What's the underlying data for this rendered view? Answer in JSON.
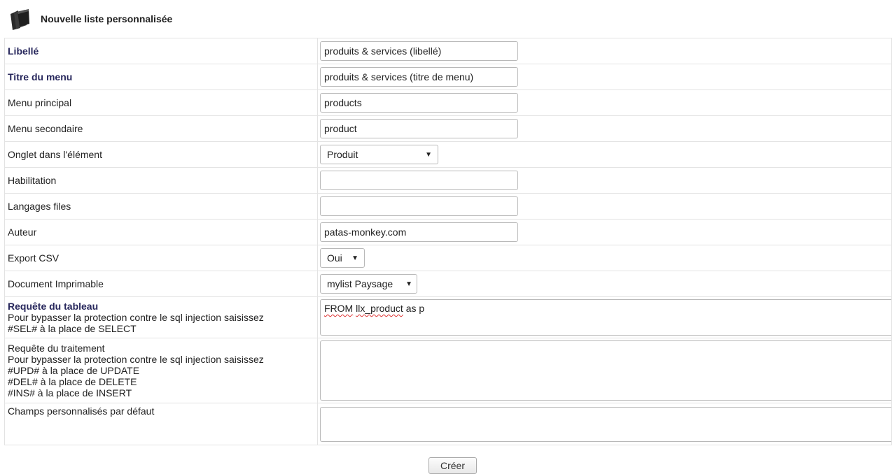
{
  "page": {
    "title": "Nouvelle liste personnalisée",
    "icon": "folder-icon"
  },
  "form": {
    "libelle": {
      "label": "Libellé",
      "value": "produits & services (libellé)"
    },
    "titre_menu": {
      "label": "Titre du menu",
      "value": "produits & services (titre de menu)"
    },
    "menu_principal": {
      "label": "Menu principal",
      "value": "products"
    },
    "menu_secondaire": {
      "label": "Menu secondaire",
      "value": "product"
    },
    "onglet": {
      "label": "Onglet dans l'élément",
      "selected": "Produit"
    },
    "habilitation": {
      "label": "Habilitation",
      "value": ""
    },
    "langages": {
      "label": "Langages files",
      "value": ""
    },
    "auteur": {
      "label": "Auteur",
      "value": "patas-monkey.com"
    },
    "export_csv": {
      "label": "Export CSV",
      "selected": "Oui"
    },
    "document": {
      "label": "Document Imprimable",
      "selected": "mylist Paysage"
    },
    "requete_tableau": {
      "label": "Requête du tableau",
      "help1": "Pour bypasser la protection contre le sql injection saisissez",
      "help2": "#SEL# à la place de SELECT",
      "value_kw1": "FROM",
      "value_kw2": "llx_product",
      "value_rest": " as p"
    },
    "requete_traitement": {
      "label": "Requête du traitement",
      "help1": "Pour bypasser la protection contre le sql injection saisissez",
      "help2": "#UPD# à la place de UPDATE",
      "help3": "#DEL# à la place de DELETE",
      "help4": "#INS# à la place de INSERT",
      "value": ""
    },
    "champs": {
      "label": "Champs personnalisés par défaut",
      "value": ""
    }
  },
  "actions": {
    "create_label": "Créer"
  }
}
